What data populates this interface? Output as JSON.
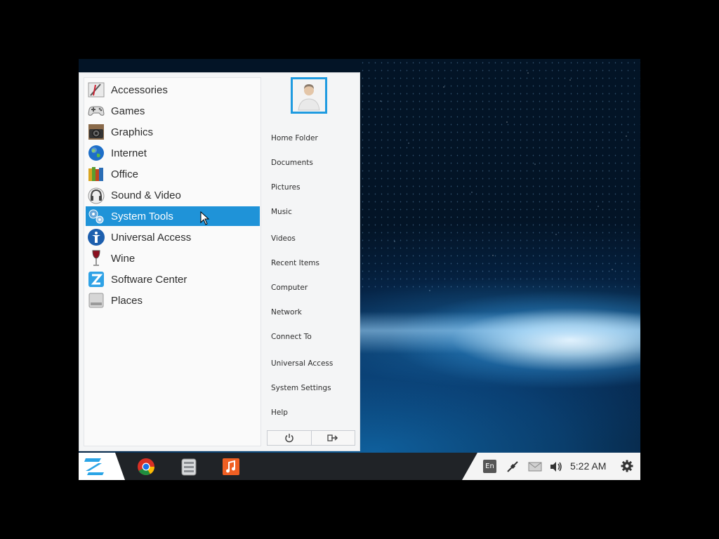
{
  "desktop": {
    "wallpaper": "space-earth-horizon"
  },
  "start_menu": {
    "apps": [
      {
        "label": "Accessories",
        "icon": "accessories-icon"
      },
      {
        "label": "Games",
        "icon": "gamepad-icon"
      },
      {
        "label": "Graphics",
        "icon": "camera-icon"
      },
      {
        "label": "Internet",
        "icon": "globe-icon"
      },
      {
        "label": "Office",
        "icon": "books-icon"
      },
      {
        "label": "Sound & Video",
        "icon": "headphones-icon"
      },
      {
        "label": "System Tools",
        "icon": "gears-icon",
        "selected": true
      },
      {
        "label": "Universal Access",
        "icon": "accessibility-icon"
      },
      {
        "label": "Wine",
        "icon": "wine-glass-icon"
      },
      {
        "label": "Software Center",
        "icon": "software-center-icon"
      },
      {
        "label": "Places",
        "icon": "drive-icon"
      }
    ],
    "places": [
      "Home Folder",
      "Documents",
      "Pictures",
      "Music",
      "Videos",
      "Recent Items",
      "Computer",
      "Network",
      "Connect To",
      "Universal Access",
      "System Settings",
      "Help"
    ],
    "user_avatar": "user-avatar-icon",
    "power_buttons": [
      "power-icon",
      "logout-icon"
    ]
  },
  "taskbar": {
    "start_icon": "zorin-logo-icon",
    "pinned": [
      "chrome-icon",
      "file-manager-icon",
      "music-player-icon"
    ],
    "tray": {
      "language": "En",
      "time": "5:22 AM",
      "icons": [
        "network-icon",
        "mail-icon",
        "volume-icon",
        "gear-icon"
      ]
    }
  },
  "colors": {
    "accent": "#1f93d8",
    "taskbar": "#202327",
    "menu_bg": "#f4f5f6"
  }
}
